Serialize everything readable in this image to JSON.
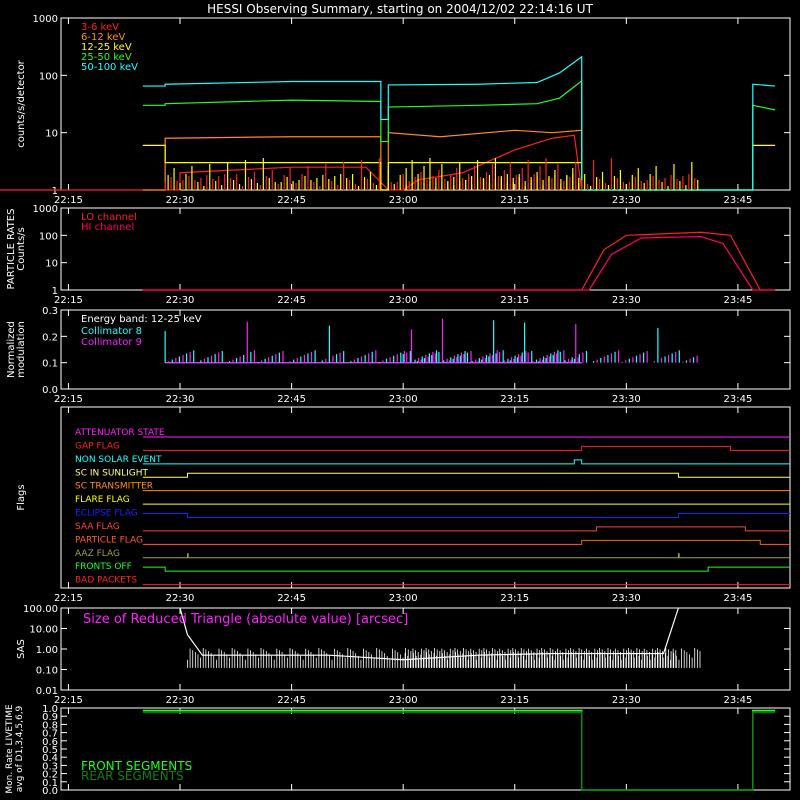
{
  "title": "HESSI Observing Summary, starting on 2004/12/02 22:14:16 UT",
  "x_ticks": [
    "22:15",
    "22:30",
    "22:45",
    "23:00",
    "23:15",
    "23:30",
    "23:45"
  ],
  "chart_data": [
    {
      "type": "line",
      "ylabel": "counts/s/detector",
      "yscale": "log",
      "ylim": [
        1,
        1000
      ],
      "y_ticks": [
        "1",
        "10",
        "100",
        "1000"
      ],
      "legend_placement": "top-left",
      "series": [
        {
          "name": "3-6 keV",
          "color": "#ff2020",
          "points": [
            [
              22.0,
              1
            ],
            [
              22.3,
              1
            ],
            [
              22.3,
              2
            ],
            [
              22.45,
              2.5
            ],
            [
              22.55,
              2.5
            ],
            [
              22.58,
              1
            ],
            [
              23.0,
              1
            ],
            [
              23.02,
              1.5
            ],
            [
              23.08,
              2
            ],
            [
              23.15,
              5
            ],
            [
              23.2,
              8
            ],
            [
              23.23,
              9
            ],
            [
              23.24,
              1
            ]
          ]
        },
        {
          "name": "6-12 keV",
          "color": "#ff8c20",
          "points": [
            [
              22.25,
              1
            ],
            [
              22.28,
              1
            ],
            [
              22.28,
              8
            ],
            [
              22.45,
              8.5
            ],
            [
              22.57,
              8.5
            ],
            [
              22.57,
              1
            ],
            [
              22.58,
              1
            ],
            [
              22.58,
              10
            ],
            [
              23.05,
              8.5
            ],
            [
              23.15,
              11
            ],
            [
              23.2,
              10
            ],
            [
              23.24,
              11
            ],
            [
              23.24,
              1
            ]
          ]
        },
        {
          "name": "12-25 keV",
          "color": "#ffff00",
          "points": [
            [
              22.25,
              6
            ],
            [
              22.28,
              6
            ],
            [
              22.28,
              3
            ],
            [
              22.57,
              3
            ],
            [
              22.57,
              1
            ],
            [
              22.58,
              1
            ],
            [
              22.58,
              3
            ],
            [
              23.24,
              3
            ],
            [
              23.24,
              1
            ],
            [
              23.47,
              1
            ],
            [
              23.47,
              6
            ],
            [
              23.5,
              6
            ]
          ]
        },
        {
          "name": "25-50 keV",
          "color": "#20ff20",
          "points": [
            [
              22.25,
              30
            ],
            [
              22.28,
              30
            ],
            [
              22.28,
              32
            ],
            [
              22.45,
              37
            ],
            [
              22.57,
              35
            ],
            [
              22.57,
              7
            ],
            [
              22.58,
              7
            ],
            [
              22.58,
              28
            ],
            [
              23.1,
              30
            ],
            [
              23.18,
              32
            ],
            [
              23.21,
              40
            ],
            [
              23.24,
              80
            ],
            [
              23.24,
              1
            ],
            [
              23.47,
              1
            ],
            [
              23.47,
              30
            ],
            [
              23.5,
              25
            ]
          ]
        },
        {
          "name": "50-100 keV",
          "color": "#20ffff",
          "points": [
            [
              22.25,
              65
            ],
            [
              22.28,
              65
            ],
            [
              22.28,
              70
            ],
            [
              22.45,
              78
            ],
            [
              22.57,
              78
            ],
            [
              22.57,
              17
            ],
            [
              22.58,
              17
            ],
            [
              22.58,
              68
            ],
            [
              23.1,
              70
            ],
            [
              23.18,
              75
            ],
            [
              23.21,
              110
            ],
            [
              23.24,
              210
            ],
            [
              23.24,
              1
            ],
            [
              23.47,
              1
            ],
            [
              23.47,
              70
            ],
            [
              23.5,
              65
            ]
          ]
        }
      ]
    },
    {
      "type": "line",
      "ylabel": "PARTICLE RATES Counts/s",
      "yscale": "log",
      "ylim": [
        1,
        1000
      ],
      "y_ticks": [
        "1",
        "10",
        "100",
        "1000"
      ],
      "legend_placement": "top-left",
      "series": [
        {
          "name": "LO channel",
          "color": "#ff2020",
          "points": [
            [
              22.25,
              1
            ],
            [
              23.24,
              1
            ],
            [
              23.27,
              30
            ],
            [
              23.3,
              100
            ],
            [
              23.4,
              130
            ],
            [
              23.44,
              100
            ],
            [
              23.48,
              1
            ],
            [
              23.5,
              1
            ]
          ]
        },
        {
          "name": "HI channel",
          "color": "#ff0060",
          "points": [
            [
              22.25,
              1
            ],
            [
              23.25,
              1
            ],
            [
              23.28,
              20
            ],
            [
              23.32,
              80
            ],
            [
              23.4,
              90
            ],
            [
              23.43,
              50
            ],
            [
              23.47,
              1
            ],
            [
              23.5,
              1
            ]
          ]
        }
      ]
    },
    {
      "type": "line",
      "ylabel": "Normalized modulation",
      "ylim": [
        0,
        0.3
      ],
      "y_ticks": [
        "0.0",
        "0.1",
        "0.2",
        "0.3"
      ],
      "annotation": "Energy band: 12-25 keV",
      "series": [
        {
          "name": "Collimator 8",
          "color": "#20ffff",
          "points": [
            [
              22.28,
              0.1
            ],
            [
              23.24,
              0.1
            ]
          ]
        },
        {
          "name": "Collimator 9",
          "color": "#ff20ff",
          "points": [
            [
              22.28,
              0.1
            ],
            [
              23.24,
              0.1
            ]
          ]
        }
      ]
    },
    {
      "type": "line",
      "ylabel": "Flags",
      "series": [
        {
          "name": "ATTENUATOR STATE",
          "color": "#ff20ff",
          "steps": [
            [
              22.25,
              0
            ],
            [
              23.5,
              0
            ]
          ]
        },
        {
          "name": "GAP FLAG",
          "color": "#ff2020",
          "steps": [
            [
              22.25,
              0
            ],
            [
              23.24,
              1
            ],
            [
              23.44,
              0
            ]
          ]
        },
        {
          "name": "NON SOLAR EVENT",
          "color": "#20ffff",
          "steps": [
            [
              22.25,
              0
            ],
            [
              23.23,
              1
            ],
            [
              23.24,
              0
            ]
          ]
        },
        {
          "name": "SC IN SUNLIGHT",
          "color": "#ffff80",
          "steps": [
            [
              22.25,
              0
            ],
            [
              22.31,
              1
            ],
            [
              23.37,
              0
            ]
          ]
        },
        {
          "name": "SC TRANSMITTER",
          "color": "#ff8c20",
          "steps": [
            [
              22.25,
              0
            ],
            [
              23.5,
              0
            ]
          ]
        },
        {
          "name": "FLARE FLAG",
          "color": "#ffff00",
          "steps": [
            [
              22.25,
              0
            ],
            [
              23.5,
              0
            ]
          ]
        },
        {
          "name": "ECLIPSE FLAG",
          "color": "#2020ff",
          "steps": [
            [
              22.25,
              1
            ],
            [
              22.31,
              0
            ],
            [
              23.37,
              1
            ]
          ]
        },
        {
          "name": "SAA FLAG",
          "color": "#ff4040",
          "steps": [
            [
              22.25,
              0
            ],
            [
              23.26,
              1
            ],
            [
              23.46,
              0
            ]
          ]
        },
        {
          "name": "PARTICLE FLAG",
          "color": "#ff6020",
          "steps": [
            [
              22.25,
              0
            ],
            [
              23.24,
              1
            ],
            [
              23.48,
              0
            ]
          ]
        },
        {
          "name": "AAZ FLAG",
          "color": "#a0a040",
          "steps": [
            [
              22.25,
              0
            ],
            [
              22.31,
              1
            ],
            [
              22.311,
              0
            ],
            [
              23.37,
              1
            ],
            [
              23.371,
              0
            ]
          ]
        },
        {
          "name": "FRONTS OFF",
          "color": "#20ff20",
          "steps": [
            [
              22.25,
              1
            ],
            [
              22.28,
              0
            ],
            [
              23.41,
              1
            ]
          ]
        },
        {
          "name": "BAD PACKETS",
          "color": "#ff2020",
          "steps": [
            [
              22.25,
              0
            ],
            [
              23.5,
              0
            ]
          ]
        }
      ]
    },
    {
      "type": "line",
      "ylabel": "SAS",
      "title": "Size of Reduced Triangle (absolute value) [arcsec]",
      "yscale": "log",
      "ylim": [
        0.01,
        100
      ],
      "y_ticks": [
        "0.01",
        "0.10",
        "1.00",
        "10.00",
        "100.00"
      ],
      "series": [
        {
          "name": "",
          "color": "#ffffff",
          "points": [
            [
              22.3,
              100
            ],
            [
              22.31,
              5
            ],
            [
              22.33,
              0.5
            ],
            [
              22.5,
              0.5
            ],
            [
              23.0,
              0.3
            ],
            [
              23.1,
              0.5
            ],
            [
              23.2,
              0.6
            ],
            [
              23.35,
              0.6
            ],
            [
              23.37,
              100
            ]
          ]
        }
      ]
    },
    {
      "type": "line",
      "ylabel": "Mon. Rate LIVETIME avg of D1,3,4,5,6,9",
      "ylim": [
        0,
        1.0
      ],
      "y_ticks": [
        "0.0",
        "0.1",
        "0.2",
        "0.3",
        "0.4",
        "0.5",
        "0.6",
        "0.7",
        "0.8",
        "0.9",
        "1.0"
      ],
      "legend_placement": "bottom-left",
      "series": [
        {
          "name": "FRONT SEGMENTS",
          "color": "#20ff20",
          "points": [
            [
              22.25,
              0.97
            ],
            [
              23.24,
              0.97
            ],
            [
              23.24,
              0
            ],
            [
              23.47,
              0
            ],
            [
              23.47,
              0.97
            ],
            [
              23.5,
              0.97
            ]
          ]
        },
        {
          "name": "REAR SEGMENTS",
          "color": "#108010",
          "points": [
            [
              22.25,
              0.95
            ],
            [
              23.24,
              0.95
            ],
            [
              23.24,
              0
            ],
            [
              23.47,
              0
            ],
            [
              23.47,
              0.95
            ],
            [
              23.5,
              0.95
            ]
          ]
        }
      ]
    }
  ]
}
